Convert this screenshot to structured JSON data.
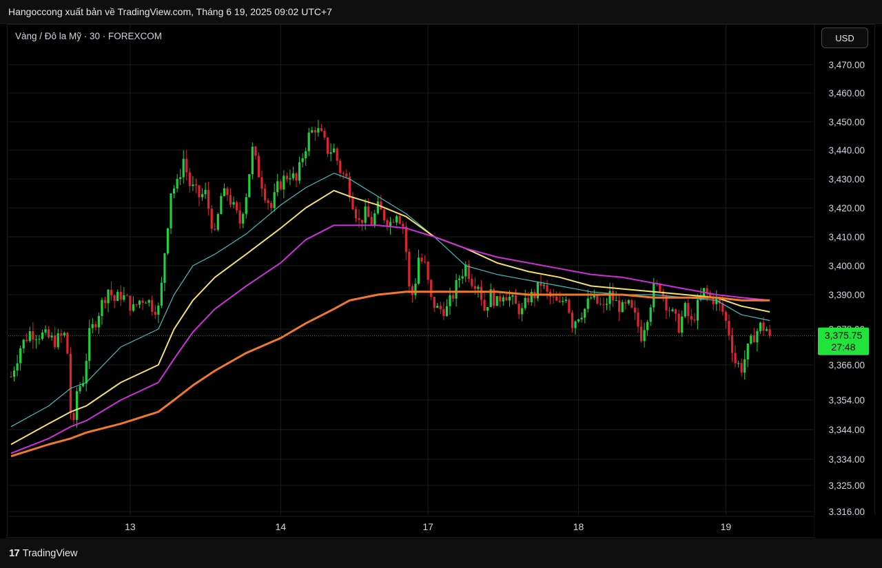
{
  "header": {
    "publish_text": "Hangoccong xuất bản về TradingView.com, Tháng 6 19, 2025 09:02 UTC+7"
  },
  "symbol": {
    "label": "Vàng / Đô la Mỹ · 30 · FOREXCOM"
  },
  "currency_button": {
    "label": "USD"
  },
  "footer": {
    "brand_logo": "17",
    "brand_name": "TradingView"
  },
  "colors": {
    "background": "#000000",
    "grid": "#1c1c1c",
    "up_candle": "#1fd13a",
    "down_candle": "#e0242f",
    "ma_fast": "#3fbfbf",
    "ma_mid": "#f5e26a",
    "ma_slow": "#d12ee0",
    "ma_long": "#f07a2a",
    "last_price_bg": "#22e33c",
    "last_price_line": "#1fa83a"
  },
  "chart_data": {
    "type": "candlestick",
    "instrument": "Vàng / Đô la Mỹ",
    "interval": "30",
    "exchange": "FOREXCOM",
    "currency": "USD",
    "x_tick_labels": [
      {
        "label": "13",
        "bar": 38
      },
      {
        "label": "14",
        "bar": 86
      },
      {
        "label": "17",
        "bar": 133
      },
      {
        "label": "18",
        "bar": 181
      },
      {
        "label": "19",
        "bar": 228
      }
    ],
    "y_tick_labels": [
      "3,470.00",
      "3,460.00",
      "3,450.00",
      "3,440.00",
      "3,430.00",
      "3,420.00",
      "3,410.00",
      "3,400.00",
      "3,390.00",
      "3,378.00",
      "3,366.00",
      "3,354.00",
      "3,344.00",
      "3,334.00",
      "3,325.00",
      "3,316.00"
    ],
    "ylim": [
      3313,
      3483
    ],
    "last_price": {
      "value": 3375.75,
      "label": "3,375.75",
      "countdown": "27:48"
    },
    "price_path": [
      [
        0,
        3362
      ],
      [
        3,
        3372
      ],
      [
        6,
        3377
      ],
      [
        10,
        3376
      ],
      [
        14,
        3374
      ],
      [
        17,
        3376
      ],
      [
        18,
        3370
      ],
      [
        19,
        3350
      ],
      [
        20,
        3345
      ],
      [
        21,
        3357
      ],
      [
        23,
        3361
      ],
      [
        25,
        3376
      ],
      [
        27,
        3381
      ],
      [
        29,
        3387
      ],
      [
        31,
        3392
      ],
      [
        33,
        3388
      ],
      [
        35,
        3390
      ],
      [
        37,
        3388
      ],
      [
        39,
        3385
      ],
      [
        41,
        3388
      ],
      [
        43,
        3389
      ],
      [
        45,
        3386
      ],
      [
        47,
        3385
      ],
      [
        48,
        3393
      ],
      [
        49,
        3405
      ],
      [
        50,
        3415
      ],
      [
        51,
        3426
      ],
      [
        53,
        3428
      ],
      [
        55,
        3437
      ],
      [
        57,
        3428
      ],
      [
        60,
        3424
      ],
      [
        62,
        3425
      ],
      [
        63,
        3420
      ],
      [
        65,
        3410
      ],
      [
        67,
        3424
      ],
      [
        69,
        3425
      ],
      [
        71,
        3420
      ],
      [
        73,
        3415
      ],
      [
        75,
        3425
      ],
      [
        77,
        3440
      ],
      [
        79,
        3432
      ],
      [
        81,
        3425
      ],
      [
        83,
        3420
      ],
      [
        85,
        3427
      ],
      [
        87,
        3430
      ],
      [
        89,
        3432
      ],
      [
        91,
        3429
      ],
      [
        93,
        3438
      ],
      [
        95,
        3445
      ],
      [
        97,
        3448
      ],
      [
        99,
        3445
      ],
      [
        101,
        3440
      ],
      [
        103,
        3440
      ],
      [
        105,
        3433
      ],
      [
        107,
        3430
      ],
      [
        109,
        3422
      ],
      [
        111,
        3415
      ],
      [
        113,
        3418
      ],
      [
        115,
        3415
      ],
      [
        117,
        3420
      ],
      [
        119,
        3417
      ],
      [
        121,
        3415
      ],
      [
        123,
        3419
      ],
      [
        125,
        3414
      ],
      [
        126,
        3405
      ],
      [
        127,
        3392
      ],
      [
        128,
        3390
      ],
      [
        129,
        3395
      ],
      [
        130,
        3403
      ],
      [
        132,
        3400
      ],
      [
        134,
        3388
      ],
      [
        136,
        3385
      ],
      [
        139,
        3385
      ],
      [
        141,
        3390
      ],
      [
        143,
        3396
      ],
      [
        145,
        3400
      ],
      [
        147,
        3395
      ],
      [
        149,
        3394
      ],
      [
        151,
        3385
      ],
      [
        153,
        3390
      ],
      [
        155,
        3387
      ],
      [
        157,
        3391
      ],
      [
        159,
        3389
      ],
      [
        161,
        3386
      ],
      [
        163,
        3384
      ],
      [
        165,
        3389
      ],
      [
        167,
        3390
      ],
      [
        169,
        3394
      ],
      [
        171,
        3390
      ],
      [
        173,
        3388
      ],
      [
        175,
        3386
      ],
      [
        177,
        3390
      ],
      [
        179,
        3380
      ],
      [
        181,
        3383
      ],
      [
        183,
        3385
      ],
      [
        185,
        3389
      ],
      [
        187,
        3387
      ],
      [
        189,
        3385
      ],
      [
        191,
        3390
      ],
      [
        193,
        3387
      ],
      [
        195,
        3385
      ],
      [
        197,
        3386
      ],
      [
        199,
        3382
      ],
      [
        201,
        3376
      ],
      [
        203,
        3383
      ],
      [
        205,
        3392
      ],
      [
        207,
        3393
      ],
      [
        209,
        3387
      ],
      [
        211,
        3383
      ],
      [
        213,
        3379
      ],
      [
        215,
        3385
      ],
      [
        217,
        3380
      ],
      [
        219,
        3386
      ],
      [
        221,
        3391
      ],
      [
        223,
        3389
      ],
      [
        225,
        3388
      ],
      [
        227,
        3384
      ],
      [
        229,
        3377
      ],
      [
        231,
        3367
      ],
      [
        233,
        3365
      ],
      [
        235,
        3371
      ],
      [
        237,
        3376
      ],
      [
        239,
        3379
      ],
      [
        241,
        3378
      ],
      [
        242,
        3375.75
      ]
    ],
    "series": [
      {
        "name": "",
        "color": "#3fbfbf",
        "points": [
          [
            0,
            3345
          ],
          [
            12,
            3352
          ],
          [
            19,
            3358
          ],
          [
            24,
            3360
          ],
          [
            35,
            3372
          ],
          [
            47,
            3378
          ],
          [
            52,
            3390
          ],
          [
            58,
            3400
          ],
          [
            65,
            3404
          ],
          [
            75,
            3411
          ],
          [
            86,
            3421
          ],
          [
            94,
            3427
          ],
          [
            103,
            3432
          ],
          [
            108,
            3430
          ],
          [
            117,
            3424
          ],
          [
            126,
            3418
          ],
          [
            135,
            3410
          ],
          [
            145,
            3400
          ],
          [
            155,
            3397
          ],
          [
            165,
            3395
          ],
          [
            175,
            3393
          ],
          [
            185,
            3391
          ],
          [
            195,
            3390
          ],
          [
            205,
            3390
          ],
          [
            215,
            3389
          ],
          [
            225,
            3388
          ],
          [
            233,
            3383
          ],
          [
            242,
            3381
          ]
        ]
      },
      {
        "name": "",
        "color": "#f5e26a",
        "points": [
          [
            0,
            3339
          ],
          [
            12,
            3346
          ],
          [
            19,
            3350
          ],
          [
            24,
            3352
          ],
          [
            35,
            3360
          ],
          [
            47,
            3366
          ],
          [
            52,
            3378
          ],
          [
            58,
            3388
          ],
          [
            65,
            3396
          ],
          [
            75,
            3404
          ],
          [
            86,
            3413
          ],
          [
            94,
            3420
          ],
          [
            103,
            3426
          ],
          [
            108,
            3424
          ],
          [
            117,
            3421
          ],
          [
            126,
            3417
          ],
          [
            135,
            3410
          ],
          [
            145,
            3406
          ],
          [
            155,
            3401
          ],
          [
            165,
            3398
          ],
          [
            175,
            3396
          ],
          [
            185,
            3393
          ],
          [
            195,
            3392
          ],
          [
            205,
            3391
          ],
          [
            215,
            3390
          ],
          [
            225,
            3389
          ],
          [
            233,
            3386
          ],
          [
            242,
            3384
          ]
        ]
      },
      {
        "name": "",
        "color": "#d12ee0",
        "points": [
          [
            0,
            3336
          ],
          [
            12,
            3341
          ],
          [
            19,
            3345
          ],
          [
            24,
            3347
          ],
          [
            35,
            3354
          ],
          [
            47,
            3360
          ],
          [
            52,
            3368
          ],
          [
            58,
            3377
          ],
          [
            65,
            3385
          ],
          [
            75,
            3393
          ],
          [
            86,
            3401
          ],
          [
            94,
            3409
          ],
          [
            103,
            3414
          ],
          [
            108,
            3414
          ],
          [
            117,
            3414
          ],
          [
            126,
            3413
          ],
          [
            135,
            3410
          ],
          [
            145,
            3406
          ],
          [
            155,
            3403
          ],
          [
            165,
            3401
          ],
          [
            175,
            3399
          ],
          [
            185,
            3397
          ],
          [
            195,
            3396
          ],
          [
            205,
            3394
          ],
          [
            215,
            3392
          ],
          [
            225,
            3390
          ],
          [
            233,
            3389
          ],
          [
            242,
            3388
          ]
        ]
      },
      {
        "name": "",
        "color": "#f07a2a",
        "points": [
          [
            0,
            3335
          ],
          [
            12,
            3339
          ],
          [
            19,
            3341
          ],
          [
            24,
            3343
          ],
          [
            35,
            3346
          ],
          [
            47,
            3350
          ],
          [
            52,
            3354
          ],
          [
            58,
            3359
          ],
          [
            65,
            3364
          ],
          [
            75,
            3370
          ],
          [
            86,
            3375
          ],
          [
            94,
            3380
          ],
          [
            103,
            3385
          ],
          [
            108,
            3388
          ],
          [
            117,
            3390
          ],
          [
            126,
            3391
          ],
          [
            135,
            3391
          ],
          [
            145,
            3391
          ],
          [
            155,
            3391
          ],
          [
            165,
            3390
          ],
          [
            175,
            3390
          ],
          [
            185,
            3390
          ],
          [
            195,
            3390
          ],
          [
            205,
            3389
          ],
          [
            215,
            3389
          ],
          [
            225,
            3389
          ],
          [
            233,
            3388
          ],
          [
            242,
            3388
          ]
        ]
      }
    ]
  }
}
